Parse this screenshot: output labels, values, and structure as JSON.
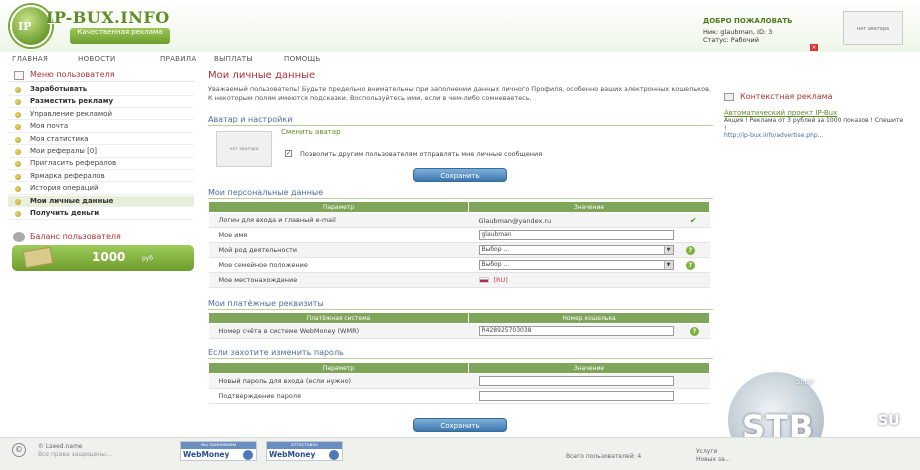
{
  "header": {
    "logo_main": "IP-BUX.INFO",
    "logo_gear": "IP",
    "logo_sub": "Качественная реклама",
    "welcome": "ДОБРО ПОЖАЛОВАТЬ",
    "user_line": "Ник: glaubman, ID: 3",
    "status_line": "Статус: Рабочий",
    "avatar_text": "нет аватара",
    "close_symbol": "×"
  },
  "nav": [
    "ГЛАВНАЯ",
    "НОВОСТИ",
    "ПРАВИЛА",
    "ВЫПЛАТЫ",
    "ПОМОЩЬ"
  ],
  "sidebar": {
    "title": "Меню пользователя",
    "items": [
      {
        "label": "Заработывать",
        "bold": true
      },
      {
        "label": "Разместить рекламу",
        "bold": true
      },
      {
        "label": "Управление рекламой",
        "bold": false
      },
      {
        "label": "Моя почта",
        "bold": false
      },
      {
        "label": "Моя статистика",
        "bold": false
      },
      {
        "label": "Мои рефералы [0]",
        "bold": false
      },
      {
        "label": "Пригласить рефералов",
        "bold": false
      },
      {
        "label": "Ярмарка рефералов",
        "bold": false
      },
      {
        "label": "История операций",
        "bold": false
      },
      {
        "label": "Мои личные данные",
        "bold": true,
        "active": true
      },
      {
        "label": "Получить деньги",
        "bold": true
      }
    ],
    "balance_title": "Баланс пользователя",
    "balance_amount": "1000",
    "balance_unit": "руб"
  },
  "main": {
    "title": "Мои личные данные",
    "intro": "Уважаемый пользователь! Будьте предельно внимательны при заполнении данных личного Профиля, особенно ваших электронных кошельков. К некоторым полям имеются подсказки. Воспользуйтесь ими, если в чем-либо сомневаетесь.",
    "avatar_section": {
      "title": "Аватар и настройки",
      "avatar_text": "нет аватара",
      "change_avatar": "Сменить аватар",
      "checkbox_mark": "✓",
      "checkbox_label": "Позволить другим пользователям отправлять мне личные сообщения",
      "save": "Сохранить"
    },
    "personal_section": {
      "title": "Мои персональные данные",
      "headers": [
        "Параметр",
        "Значение"
      ],
      "rows": [
        {
          "label": "Логин для входа и главный e-mail",
          "value": "Glaubman@yandex.ru",
          "kind": "text",
          "mark": "check"
        },
        {
          "label": "Мое имя",
          "value": "glaubman",
          "kind": "input",
          "mark": ""
        },
        {
          "label": "Мой род деятельности",
          "value": "Выбор ...",
          "kind": "select",
          "mark": "help"
        },
        {
          "label": "Мое семейное положение",
          "value": "Выбор ...",
          "kind": "select",
          "mark": "help"
        },
        {
          "label": "Мое местонахождение",
          "value": "[RU]",
          "kind": "flag",
          "mark": ""
        }
      ]
    },
    "payment_section": {
      "title": "Мои платёжные реквизиты",
      "headers": [
        "Платёжная система",
        "Номер кошелька"
      ],
      "rows": [
        {
          "label": "Номер счёта в системе WebMoney (WMR)",
          "value": "R428925703038",
          "mark": "help"
        }
      ]
    },
    "password_section": {
      "title": "Если захотите изменить пароль",
      "headers": [
        "Параметр",
        "Значение"
      ],
      "rows": [
        {
          "label": "Новый пароль для входа (если нужно)",
          "value": ""
        },
        {
          "label": "Подтверждение пароля",
          "value": ""
        }
      ],
      "save": "Сохранить"
    }
  },
  "right": {
    "title": "Контекстная реклама",
    "ad_head": "Автоматический проект IP-Bux",
    "ad_body": "Акция ! Реклама от 3 рублей за 1000 показов ! Спешите !",
    "ad_link": "http://ip-bux.info/advertise.php..."
  },
  "badge": {
    "text": "STB",
    "su": "SU",
    "shop": "Shop"
  },
  "footer": {
    "copy_symbol": "©",
    "line1": "© Lseed.name",
    "line2": "Все права защищены...",
    "wm1_top": "мы принимаем",
    "wm1_bottom": "WebMoney",
    "wm2_top": "аттестован",
    "wm2_bottom": "WebMoney",
    "right1": "Услуги",
    "right2": "Всего пользователей: 4",
    "right3": "Новых за..."
  },
  "colors": {
    "accent_green": "#7ea55a",
    "title_red": "#a33",
    "button_blue": "#3d78ad"
  }
}
